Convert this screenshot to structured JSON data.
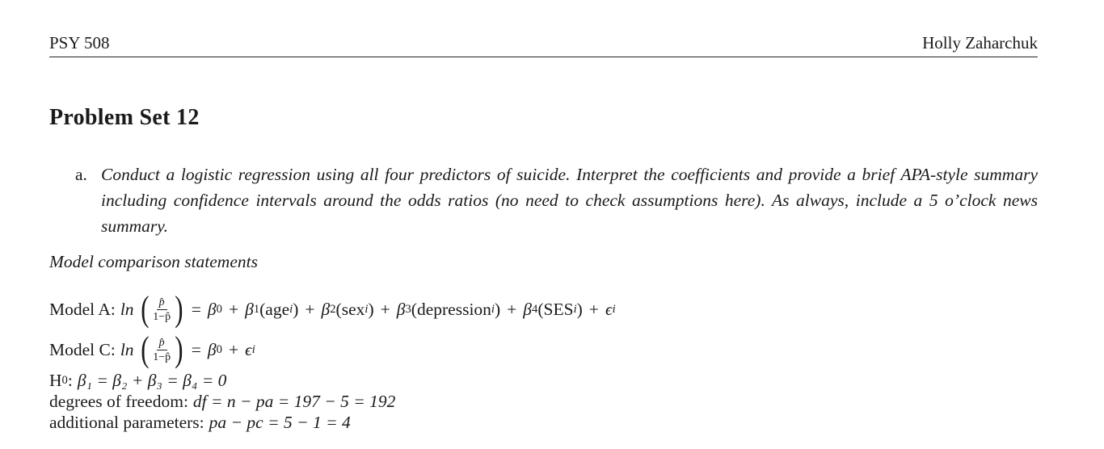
{
  "header": {
    "course": "PSY 508",
    "author": "Holly Zaharchuk"
  },
  "title": "Problem Set 12",
  "question": {
    "marker": "a.",
    "text": "Conduct a logistic regression using all four predictors of suicide. Interpret the coefficients and provide a brief APA-style summary including confidence intervals around the odds ratios (no need to check assumptions here). As always, include a 5 o’clock news summary."
  },
  "subheading": "Model comparison statements",
  "model_a": {
    "label": "Model A:",
    "ln": "ln",
    "frac_num": "p̂",
    "frac_den": "1−p̂",
    "rhs_prefix": "β",
    "terms": [
      "age",
      "sex",
      "depression",
      "SES"
    ],
    "error": "ϵ"
  },
  "model_c": {
    "label": "Model C:",
    "ln": "ln",
    "frac_num": "p̂",
    "frac_den": "1−p̂"
  },
  "null_hypothesis": {
    "label": "H",
    "label_sub": "0",
    "expression": "β₁ = β₂ + β₃ = β₄ = 0"
  },
  "degrees_of_freedom": {
    "label": "degrees of freedom:",
    "expression": "df = n − pa = 197 − 5 = 192"
  },
  "additional_parameters": {
    "label": "additional parameters:",
    "expression": "pa − pc = 5 − 1 = 4"
  }
}
